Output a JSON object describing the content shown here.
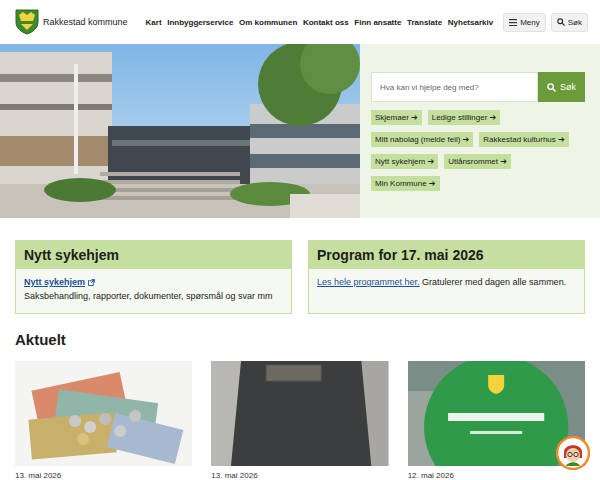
{
  "header": {
    "logo_text": "Rakkestad kommune",
    "nav": [
      "Kart",
      "Innbyggerservice",
      "Om kommunen",
      "Kontakt oss",
      "Finn ansatte",
      "Translate",
      "Nyhetsarkiv"
    ],
    "menu_button": "Meny",
    "search_button": "Søk"
  },
  "hero": {
    "search": {
      "placeholder": "Hva kan vi hjelpe deg med?",
      "button": "Søk"
    },
    "link_arrow": "➔",
    "quick_links": [
      "Skjemaer",
      "Ledige stillinger",
      "Mitt nabolag (melde feil)",
      "Rakkestad kulturhus",
      "Nytt sykehjem",
      "Utlånsrommet",
      "Min Kommune"
    ]
  },
  "cards": [
    {
      "title": "Nytt sykehjem",
      "link": "Nytt sykehjem",
      "link_external": true,
      "text": "Saksbehandling, rapporter, dokumenter, spørsmål og svar mm"
    },
    {
      "title": "Program for 17. mai 2026",
      "link": "Les hele programmet her.",
      "link_external": false,
      "text": "Gratulerer med dagen alle sammen."
    }
  ],
  "news": {
    "title": "Aktuelt",
    "items": [
      {
        "date": "13. mai 2026",
        "kind": "money"
      },
      {
        "date": "13. mai 2026",
        "kind": "road"
      },
      {
        "date": "12. mai 2026",
        "kind": "poster"
      }
    ]
  }
}
